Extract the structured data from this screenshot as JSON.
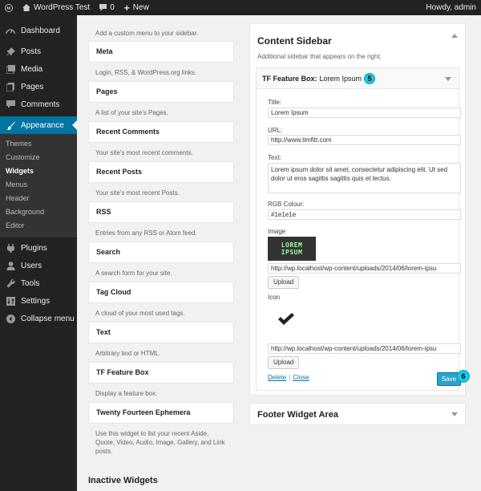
{
  "adminbar": {
    "site_name": "WordPress Test",
    "comments_count": "0",
    "new_label": "New",
    "howdy": "Howdy, admin"
  },
  "menu": {
    "dashboard": "Dashboard",
    "posts": "Posts",
    "media": "Media",
    "pages": "Pages",
    "comments": "Comments",
    "appearance": "Appearance",
    "sub": [
      "Themes",
      "Customize",
      "Widgets",
      "Menus",
      "Header",
      "Background",
      "Editor"
    ],
    "plugins": "Plugins",
    "users": "Users",
    "tools": "Tools",
    "settings": "Settings",
    "collapse": "Collapse menu"
  },
  "available": {
    "first_desc": "Add a custom menu to your sidebar.",
    "widgets": [
      {
        "title": "Meta",
        "desc": "Login, RSS, & WordPress.org links."
      },
      {
        "title": "Pages",
        "desc": "A list of your site's Pages."
      },
      {
        "title": "Recent Comments",
        "desc": "Your site's most recent comments."
      },
      {
        "title": "Recent Posts",
        "desc": "Your site's most recent Posts."
      },
      {
        "title": "RSS",
        "desc": "Entries from any RSS or Atom feed."
      },
      {
        "title": "Search",
        "desc": "A search form for your site."
      },
      {
        "title": "Tag Cloud",
        "desc": "A cloud of your most used tags."
      },
      {
        "title": "Text",
        "desc": "Arbitrary text or HTML."
      },
      {
        "title": "TF Feature Box",
        "desc": "Display a feature box."
      },
      {
        "title": "Twenty Fourteen Ephemera",
        "desc": "Use this widget to list your recent Aside, Quote, Video, Audio, Image, Gallery, and Link posts."
      }
    ]
  },
  "content_sidebar": {
    "title": "Content Sidebar",
    "desc": "Additional sidebar that appears on the right."
  },
  "widget": {
    "name": "TF Feature Box:",
    "instance_title": "Lorem Ipsum",
    "callout_header": "5",
    "callout_save": "6",
    "title_label": "Title:",
    "title_value": "Lorem Ipsum",
    "url_label": "URL:",
    "url_value": "http://www.timfitt.com",
    "text_label": "Text:",
    "text_value": "Lorem ipsum dolor sit amet, consectetur adipiscing elit. Ut sed dolor ut eros sagittis sagittis quis et lectus.",
    "rgb_label": "RGB Colour:",
    "rgb_value": "#1e1e1e",
    "image_label": "Image",
    "image_text_1": "LOREM",
    "image_text_2": "IPSUM",
    "image_url": "http://wp.localhost/wp-content/uploads/2014/06/lorem-ipsu",
    "upload_label": "Upload",
    "icon_label": "Icon",
    "icon_url": "http://wp.localhost/wp-content/uploads/2014/06/lorem-ipsu",
    "delete_label": "Delete",
    "close_label": "Close",
    "save_label": "Save"
  },
  "footer_area": {
    "title": "Footer Widget Area"
  },
  "inactive": {
    "title": "Inactive Widgets"
  },
  "colors": {
    "accent": "#0074a2",
    "save": "#2ea2cc",
    "callout": "#17c9e8"
  }
}
